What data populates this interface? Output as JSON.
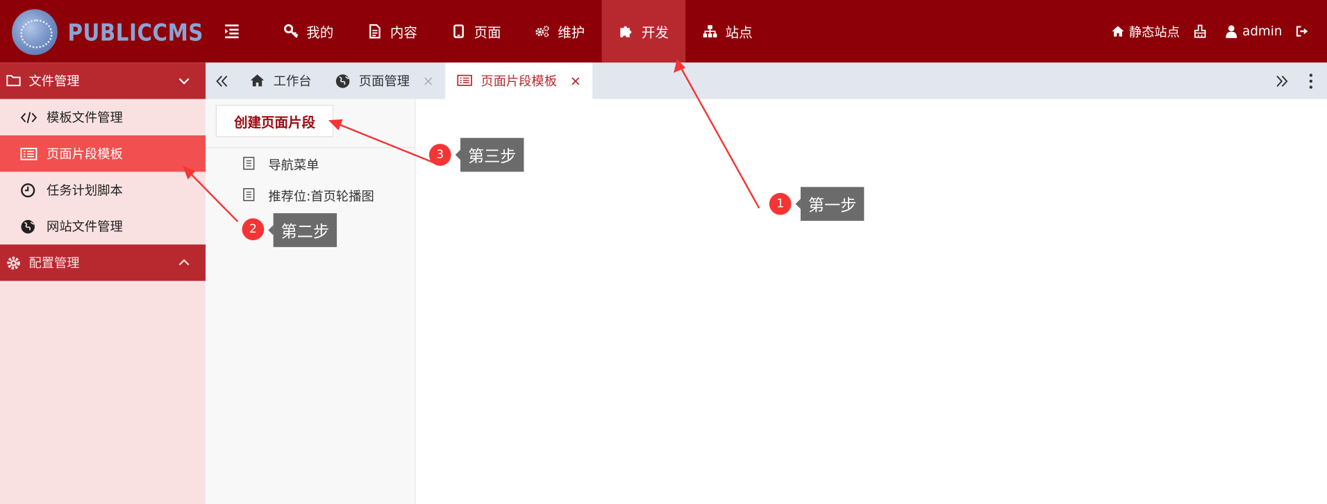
{
  "app": {
    "logo_text": "PUBLICCMS"
  },
  "top_nav": {
    "items": [
      {
        "label": "我的",
        "icon": "key-icon"
      },
      {
        "label": "内容",
        "icon": "file-text-icon"
      },
      {
        "label": "页面",
        "icon": "tablet-icon"
      },
      {
        "label": "维护",
        "icon": "gears-icon"
      },
      {
        "label": "开发",
        "icon": "puzzle-icon",
        "active": true
      },
      {
        "label": "站点",
        "icon": "sitemap-icon"
      }
    ],
    "right": {
      "static_site_label": "静态站点",
      "user_label": "admin"
    }
  },
  "sidebar": {
    "groups": [
      {
        "label": "文件管理",
        "expanded": true,
        "items": [
          {
            "label": "模板文件管理",
            "icon": "code-icon"
          },
          {
            "label": "页面片段模板",
            "icon": "list-icon",
            "active": true
          },
          {
            "label": "任务计划脚本",
            "icon": "clock-icon"
          },
          {
            "label": "网站文件管理",
            "icon": "globe-icon"
          }
        ]
      },
      {
        "label": "配置管理",
        "expanded": false,
        "items": []
      }
    ]
  },
  "tabs": {
    "items": [
      {
        "label": "工作台",
        "icon": "home-icon",
        "closable": false
      },
      {
        "label": "页面管理",
        "icon": "globe-icon",
        "closable": true
      },
      {
        "label": "页面片段模板",
        "icon": "list-icon",
        "closable": true,
        "active": true
      }
    ]
  },
  "tree": {
    "create_button": "创建页面片段",
    "items": [
      {
        "label": "导航菜单"
      },
      {
        "label": "推荐位:首页轮播图"
      }
    ]
  },
  "annotations": [
    {
      "number": "1",
      "label": "第一步"
    },
    {
      "number": "2",
      "label": "第二步"
    },
    {
      "number": "3",
      "label": "第三步"
    }
  ],
  "colors": {
    "topbar": "#8e0007",
    "topbar_active": "#b8292f",
    "sidebar_bg": "#fae1e1",
    "sidebar_active": "#f25050",
    "annotation_red": "#f53434",
    "annotation_label_bg": "#6b6b6b"
  }
}
